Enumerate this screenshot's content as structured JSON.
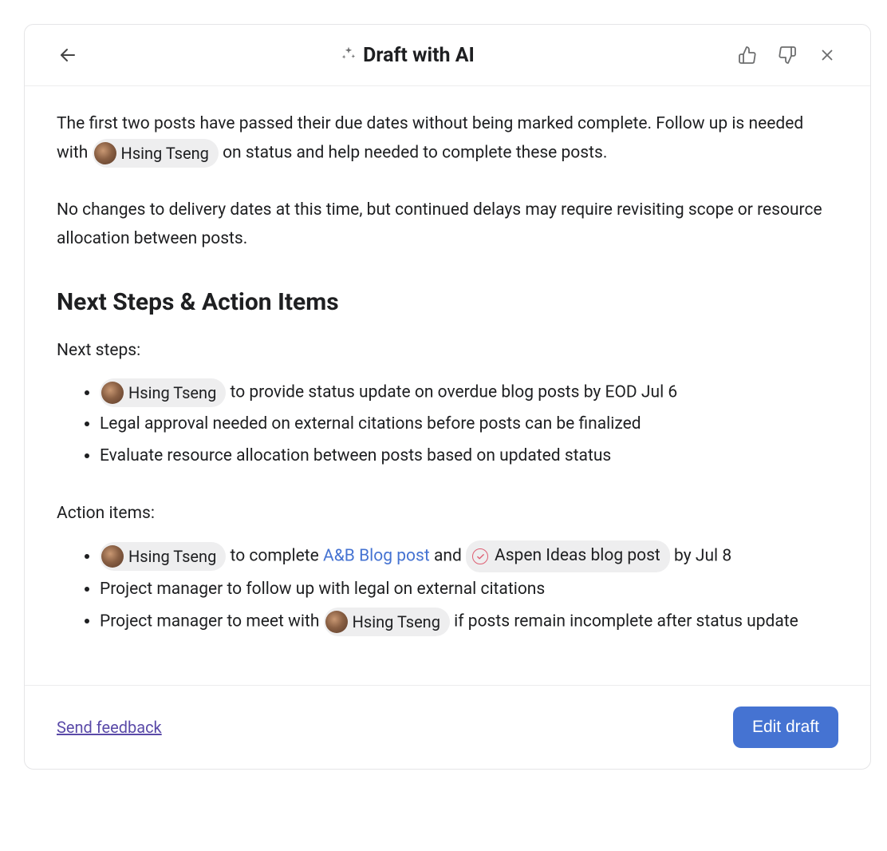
{
  "header": {
    "title": "Draft with AI"
  },
  "content": {
    "intro_before_mention": "The first two posts have passed their due dates without being marked complete. Follow up is needed with ",
    "intro_after_mention": " on status and help needed to complete these posts.",
    "intro_para2": "No changes to delivery dates at this time, but continued delays may require revisiting scope or resource allocation between posts.",
    "section_heading": "Next Steps & Action Items",
    "next_steps_label": "Next steps:",
    "next_steps": {
      "item1_after_mention": " to provide status update on overdue blog posts by EOD Jul 6",
      "item2": "Legal approval needed on external citations before posts can be finalized",
      "item3": "Evaluate resource allocation between posts based on updated status"
    },
    "action_items_label": "Action items:",
    "action_items": {
      "item1_after_mention": " to complete ",
      "item1_link": "A&B Blog post",
      "item1_between": " and ",
      "item1_chip": "Aspen Ideas blog post",
      "item1_tail": " by Jul 8",
      "item2": "Project manager to follow up with legal on external citations",
      "item3_before_mention": "Project manager to meet with ",
      "item3_after_mention": " if posts remain incomplete after status update"
    }
  },
  "mentions": {
    "hsing": "Hsing Tseng"
  },
  "footer": {
    "feedback_label": "Send feedback",
    "edit_button_label": "Edit draft"
  }
}
